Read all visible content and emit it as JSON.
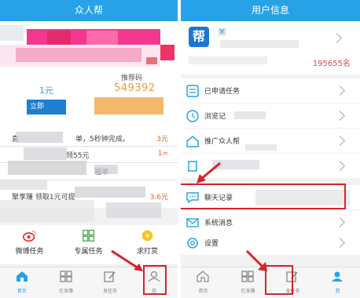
{
  "left": {
    "header_title": "众人帮",
    "balance": "1元",
    "referral_label": "推荐码",
    "referral_code": "549392",
    "invite_button": "立即",
    "tasks": [
      {
        "text": "直",
        "suffix": "单，5秒钟完成。",
        "amount": "3元"
      },
      {
        "text": "",
        "suffix": "领55元",
        "amount": "1="
      },
      {
        "text": "",
        "suffix": "福单",
        "amount": ""
      },
      {
        "text": "聚享赚 领取1元可提",
        "suffix": "",
        "amount": "3.6元"
      }
    ],
    "features": [
      {
        "label": "微博任务",
        "icon": "weibo-icon"
      },
      {
        "label": "专属任务",
        "icon": "grid-icon"
      },
      {
        "label": "求打赏",
        "icon": "coin-icon"
      }
    ],
    "tabs": [
      {
        "label": "首页",
        "icon": "home-icon",
        "active": true
      },
      {
        "label": "在发赚",
        "icon": "grid-tab-icon",
        "active": false
      },
      {
        "label": "发任务",
        "icon": "edit-icon",
        "active": false
      },
      {
        "label": "我",
        "icon": "user-icon",
        "active": false
      }
    ]
  },
  "right": {
    "header_title": "用户信息",
    "logo_text": "帮",
    "vip_badge": "V",
    "score": "195655名",
    "menu": [
      {
        "label": "已申请任务",
        "icon": "task-list-icon"
      },
      {
        "label": "浏览记",
        "icon": "clock-icon"
      },
      {
        "label": "推广众人帮",
        "icon": "home-outline-icon"
      },
      {
        "label": "",
        "icon": "blank-icon"
      },
      {
        "label": "聊天记录",
        "icon": "chat-icon"
      },
      {
        "label": "系统消息",
        "icon": "mail-icon"
      },
      {
        "label": "设置",
        "icon": "settings-icon"
      }
    ],
    "tabs": [
      {
        "label": "首页",
        "icon": "home-icon",
        "active": false
      },
      {
        "label": "在发赚",
        "icon": "grid-tab-icon",
        "active": false
      },
      {
        "label": "发任务",
        "icon": "edit-icon",
        "active": false
      },
      {
        "label": "我",
        "icon": "user-icon",
        "active": true
      }
    ]
  },
  "colors": {
    "header_blue": "#27a2e7",
    "accent_orange": "#f29b3b",
    "annotation_red": "#d8232a"
  }
}
